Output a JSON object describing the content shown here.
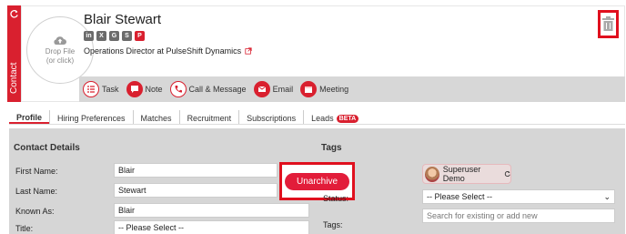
{
  "ribbon": {
    "label": "Contact"
  },
  "contact": {
    "name": "Blair Stewart",
    "job_title": "Operations Director at PulseShift Dynamics",
    "socials": [
      "in",
      "X",
      "G",
      "S",
      "P"
    ]
  },
  "dropzone": {
    "line1": "Drop File",
    "line2": "(or click)"
  },
  "actions": [
    {
      "label": "Task",
      "icon": "task-icon"
    },
    {
      "label": "Note",
      "icon": "note-icon"
    },
    {
      "label": "Call & Message",
      "icon": "phone-icon"
    },
    {
      "label": "Email",
      "icon": "email-icon"
    },
    {
      "label": "Meeting",
      "icon": "calendar-icon"
    }
  ],
  "tabs": [
    {
      "label": "Profile",
      "active": true
    },
    {
      "label": "Hiring Preferences"
    },
    {
      "label": "Matches"
    },
    {
      "label": "Recruitment"
    },
    {
      "label": "Subscriptions"
    },
    {
      "label": "Leads",
      "badge": "BETA"
    }
  ],
  "contact_details": {
    "title": "Contact Details",
    "fields": [
      {
        "label": "First Name:",
        "value": "Blair"
      },
      {
        "label": "Last Name:",
        "value": "Stewart"
      },
      {
        "label": "Known As:",
        "value": "Blair"
      },
      {
        "label": "Title:",
        "value": "-- Please Select --"
      }
    ]
  },
  "unarchive": {
    "label": "Unarchive"
  },
  "tags": {
    "title": "Tags",
    "owner": "Superuser Demo",
    "status_label": "Status:",
    "status_value": "-- Please Select --",
    "search_placeholder": "Search for existing or add new",
    "tags_label": "Tags:"
  },
  "colors": {
    "accent": "#d9202f",
    "highlight_border": "#e0101e",
    "panel_bg": "#d6d6d6"
  }
}
